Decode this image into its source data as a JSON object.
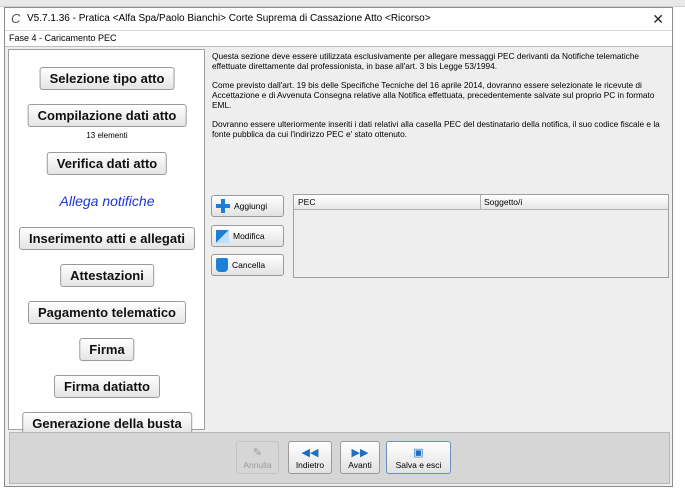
{
  "window": {
    "title": "V5.7.1.36 - Pratica <Alfa Spa/Paolo Bianchi>   Corte Suprema di Cassazione   Atto <Ricorso>",
    "app_icon": "C",
    "close_label": "✕"
  },
  "phase": {
    "title": "Fase 4 - Caricamento PEC"
  },
  "steps": [
    {
      "label": "Selezione tipo atto"
    },
    {
      "label": "Compilazione dati atto",
      "sub": "13 elementi"
    },
    {
      "label": "Verifica dati atto"
    },
    {
      "label": "Allega notifiche",
      "active": true
    },
    {
      "label": "Inserimento atti e allegati"
    },
    {
      "label": "Attestazioni"
    },
    {
      "label": "Pagamento telematico"
    },
    {
      "label": "Firma"
    },
    {
      "label": "Firma datiatto"
    },
    {
      "label": "Generazione della busta"
    }
  ],
  "description": [
    "Questa sezione deve essere utilizzata esclusivamente per allegare messaggi PEC derivanti da Notifiche telematiche effettuate direttamente dal professionista, in base all'art. 3 bis Legge 53/1994.",
    "Come previsto dall'art. 19 bis delle Specifiche Tecniche del 16 aprile 2014, dovranno essere selezionate le ricevute di Accettazione e di Avvenuta Consegna relative alla Notifica effettuata, precedentemente salvate sul proprio PC in formato EML.",
    "Dovranno essere ulteriormente inseriti i dati relativi alla casella PEC del destinatario della notifica, il suo codice fiscale e la fonte pubblica da cui l'indirizzo PEC e' stato ottenuto."
  ],
  "actions": {
    "add": "Aggiungi",
    "edit": "Modifica",
    "delete": "Cancella"
  },
  "table": {
    "columns": [
      "PEC",
      "Soggetto/i"
    ],
    "rows": []
  },
  "footer": {
    "cancel": "Annulla",
    "back": "Indietro",
    "forward": "Avanti",
    "save_exit": "Salva e esci"
  },
  "colors": {
    "accent": "#1e7fd6",
    "active_step": "#1a34d8"
  }
}
